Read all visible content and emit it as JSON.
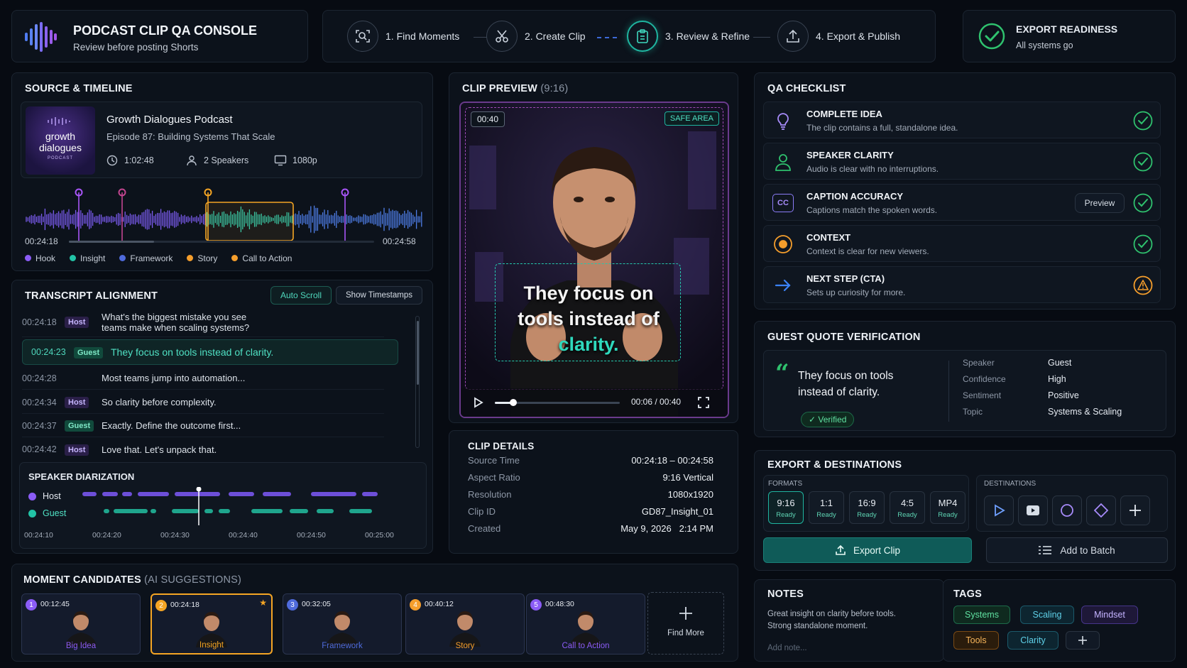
{
  "header": {
    "app_title": "PODCAST CLIP QA CONSOLE",
    "app_subtitle": "Review before posting Shorts",
    "steps": [
      {
        "label": "1. Find Moments"
      },
      {
        "label": "2. Create Clip"
      },
      {
        "label": "3. Review & Refine"
      },
      {
        "label": "4. Export & Publish"
      }
    ],
    "readiness_title": "EXPORT READINESS",
    "readiness_status": "All systems go"
  },
  "source": {
    "section_title": "SOURCE & TIMELINE",
    "cover_line1": "growth",
    "cover_line2": "dialogues",
    "cover_line3": "PODCAST",
    "podcast_name": "Growth Dialogues Podcast",
    "episode": "Episode 87: Building Systems That Scale",
    "duration": "1:02:48",
    "speakers": "2 Speakers",
    "resolution": "1080p",
    "range_start": "00:24:18",
    "range_end": "00:24:58",
    "legend": [
      {
        "label": "Hook",
        "color": "#8b5cf6"
      },
      {
        "label": "Insight",
        "color": "#22c3a6"
      },
      {
        "label": "Framework",
        "color": "#4f6bdc"
      },
      {
        "label": "Story",
        "color": "#f59e2c"
      },
      {
        "label": "Call to Action",
        "color": "#f59e2c"
      }
    ]
  },
  "transcript": {
    "section_title": "TRANSCRIPT ALIGNMENT",
    "auto_scroll": "Auto Scroll",
    "show_timestamps": "Show Timestamps",
    "rows": [
      {
        "time": "00:24:18",
        "speaker": "Host",
        "text": "What's the biggest mistake you see teams make when scaling systems?"
      },
      {
        "time": "00:24:23",
        "speaker": "Guest",
        "text": "They focus on tools instead of clarity."
      },
      {
        "time": "00:24:28",
        "speaker": "",
        "text": "Most teams jump into automation..."
      },
      {
        "time": "00:24:34",
        "speaker": "Host",
        "text": "So clarity before complexity."
      },
      {
        "time": "00:24:37",
        "speaker": "Guest",
        "text": "Exactly. Define the outcome first..."
      },
      {
        "time": "00:24:42",
        "speaker": "Host",
        "text": "Love that. Let's unpack that."
      }
    ]
  },
  "diarization": {
    "section_title": "SPEAKER DIARIZATION",
    "host_label": "Host",
    "guest_label": "Guest",
    "ticks": [
      "00:24:10",
      "00:24:20",
      "00:24:30",
      "00:24:40",
      "00:24:50",
      "00:25:00"
    ]
  },
  "preview": {
    "section_title": "CLIP PREVIEW",
    "ratio_label": "(9:16)",
    "duration_badge": "00:40",
    "safe_area": "SAFE AREA",
    "caption_line1": "They focus on",
    "caption_line2": "tools instead of",
    "caption_line3": "clarity.",
    "time_readout": "00:06 / 00:40",
    "progress": 0.15
  },
  "details": {
    "section_title": "CLIP DETAILS",
    "rows": [
      {
        "label": "Source Time",
        "value": "00:24:18 – 00:24:58"
      },
      {
        "label": "Aspect Ratio",
        "value": "9:16 Vertical"
      },
      {
        "label": "Resolution",
        "value": "1080x1920"
      },
      {
        "label": "Clip ID",
        "value": "GD87_Insight_01"
      },
      {
        "label": "Created",
        "value": "May 9, 2026   2:14 PM"
      }
    ]
  },
  "checklist": {
    "section_title": "QA CHECKLIST",
    "preview_button": "Preview",
    "items": [
      {
        "name": "COMPLETE IDEA",
        "desc": "The clip contains a full, standalone idea.",
        "icon": "lightbulb-icon",
        "status": "pass"
      },
      {
        "name": "SPEAKER CLARITY",
        "desc": "Audio is clear with no interruptions.",
        "icon": "person-icon",
        "status": "pass"
      },
      {
        "name": "CAPTION ACCURACY",
        "desc": "Captions match the spoken words.",
        "icon": "captions-icon",
        "status": "pass"
      },
      {
        "name": "CONTEXT",
        "desc": "Context is clear for new viewers.",
        "icon": "target-icon",
        "status": "pass"
      },
      {
        "name": "NEXT STEP (CTA)",
        "desc": "Sets up curiosity for more.",
        "icon": "arrow-right-icon",
        "status": "warning"
      }
    ],
    "cc_glyph": "CC"
  },
  "quote": {
    "section_title": "GUEST QUOTE VERIFICATION",
    "text_line1": "They focus on tools",
    "text_line2": "instead of clarity.",
    "verified": "Verified",
    "fields": [
      {
        "key": "Speaker",
        "value": "Guest"
      },
      {
        "key": "Confidence",
        "value": "High"
      },
      {
        "key": "Sentiment",
        "value": "Positive"
      },
      {
        "key": "Topic",
        "value": "Systems & Scaling"
      }
    ]
  },
  "export": {
    "section_title": "EXPORT & DESTINATIONS",
    "formats_label": "FORMATS",
    "destinations_label": "DESTINATIONS",
    "formats": [
      {
        "ratio": "9:16",
        "status": "Ready"
      },
      {
        "ratio": "1:1",
        "status": "Ready"
      },
      {
        "ratio": "16:9",
        "status": "Ready"
      },
      {
        "ratio": "4:5",
        "status": "Ready"
      },
      {
        "ratio": "MP4",
        "status": "Ready"
      }
    ],
    "export_button": "Export Clip",
    "batch_button": "Add to Batch"
  },
  "notes": {
    "section_title": "NOTES",
    "text_line1": "Great insight on clarity before tools.",
    "text_line2": "Strong standalone moment.",
    "placeholder": "Add note..."
  },
  "tags": {
    "section_title": "TAGS",
    "items": [
      "Systems",
      "Scaling",
      "Mindset",
      "Tools",
      "Clarity"
    ]
  },
  "candidates": {
    "section_title": "MOMENT CANDIDATES",
    "section_subtitle": "(AI SUGGESTIONS)",
    "items": [
      {
        "num": "1",
        "time": "00:12:45",
        "label": "Big Idea",
        "color": "#8b5cf6"
      },
      {
        "num": "2",
        "time": "00:24:18",
        "label": "Insight",
        "color": "#f5a524"
      },
      {
        "num": "3",
        "time": "00:32:05",
        "label": "Framework",
        "color": "#4f6bdc"
      },
      {
        "num": "4",
        "time": "00:40:12",
        "label": "Story",
        "color": "#f59e2c"
      },
      {
        "num": "5",
        "time": "00:48:30",
        "label": "Call to Action",
        "color": "#8b5cf6"
      }
    ],
    "find_more": "Find More"
  }
}
